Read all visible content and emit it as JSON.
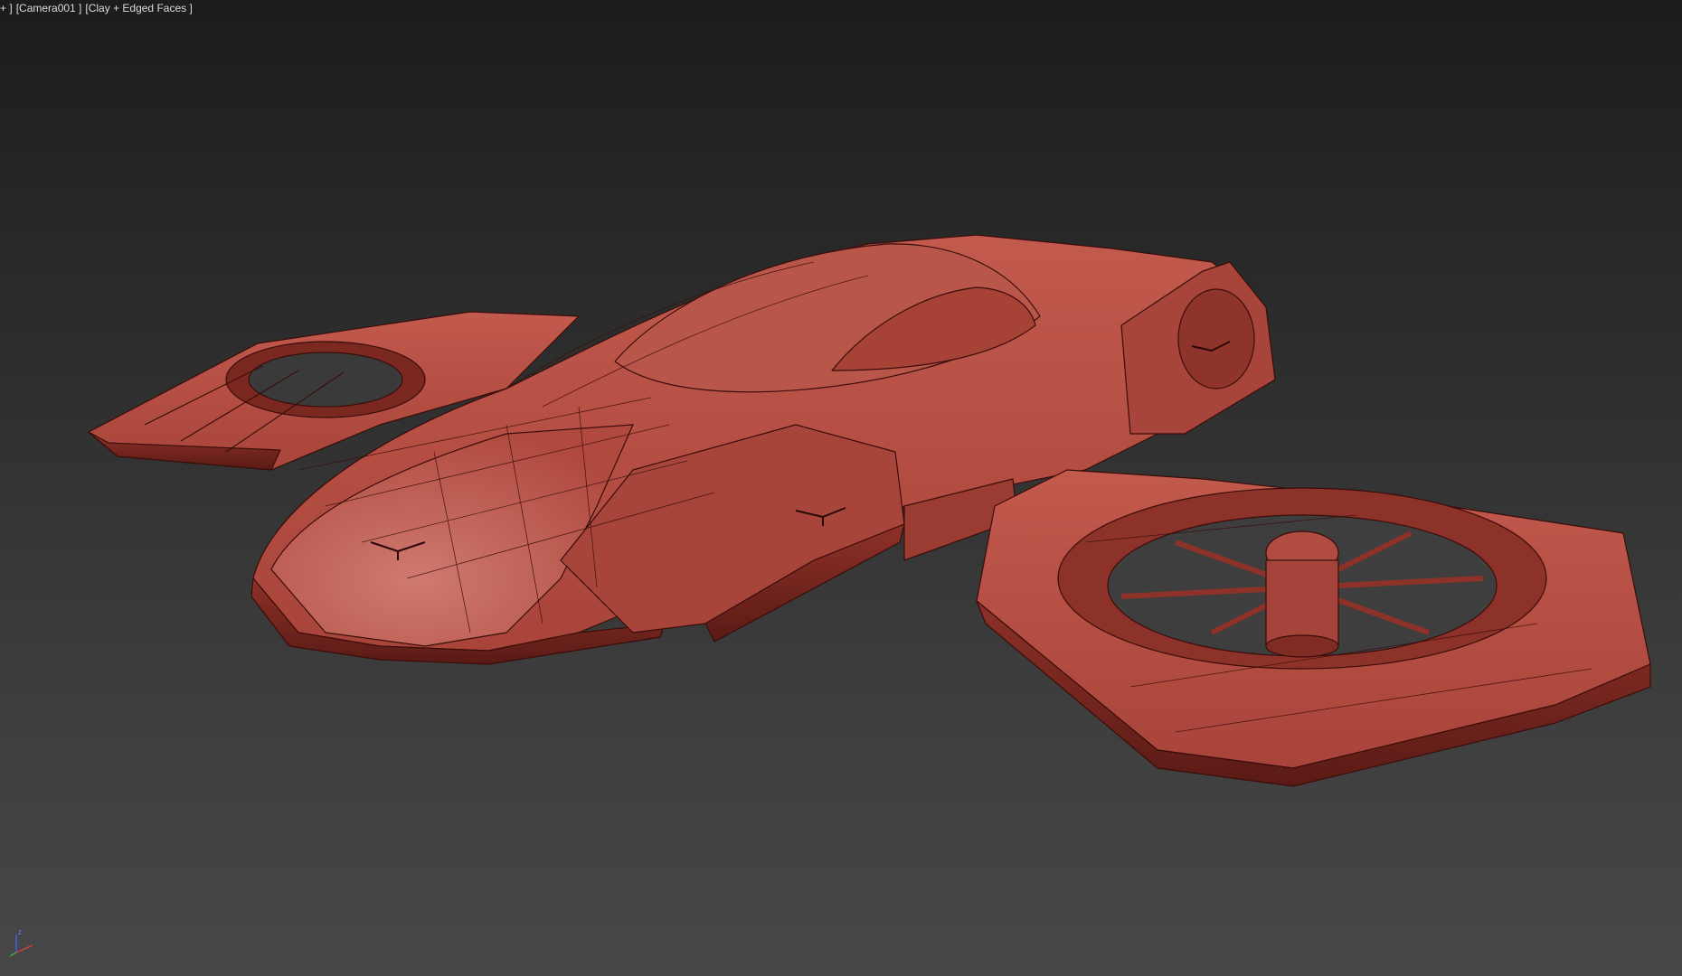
{
  "viewport": {
    "menu_plus": "+ ]",
    "camera_label": "[Camera001 ]",
    "shading_label": "[Clay + Edged Faces ]"
  },
  "gizmo": {
    "z_label": "z",
    "x_color": "#d04040",
    "y_color": "#40b040",
    "z_color": "#4060e0"
  },
  "scene": {
    "object": "flying-vehicle-model",
    "clay_color": "#b5473c",
    "clay_shadow_color": "#5a1a15",
    "edge_color": "#3a0d0a",
    "background_top": "#1c1c1c",
    "background_bottom": "#474747"
  }
}
